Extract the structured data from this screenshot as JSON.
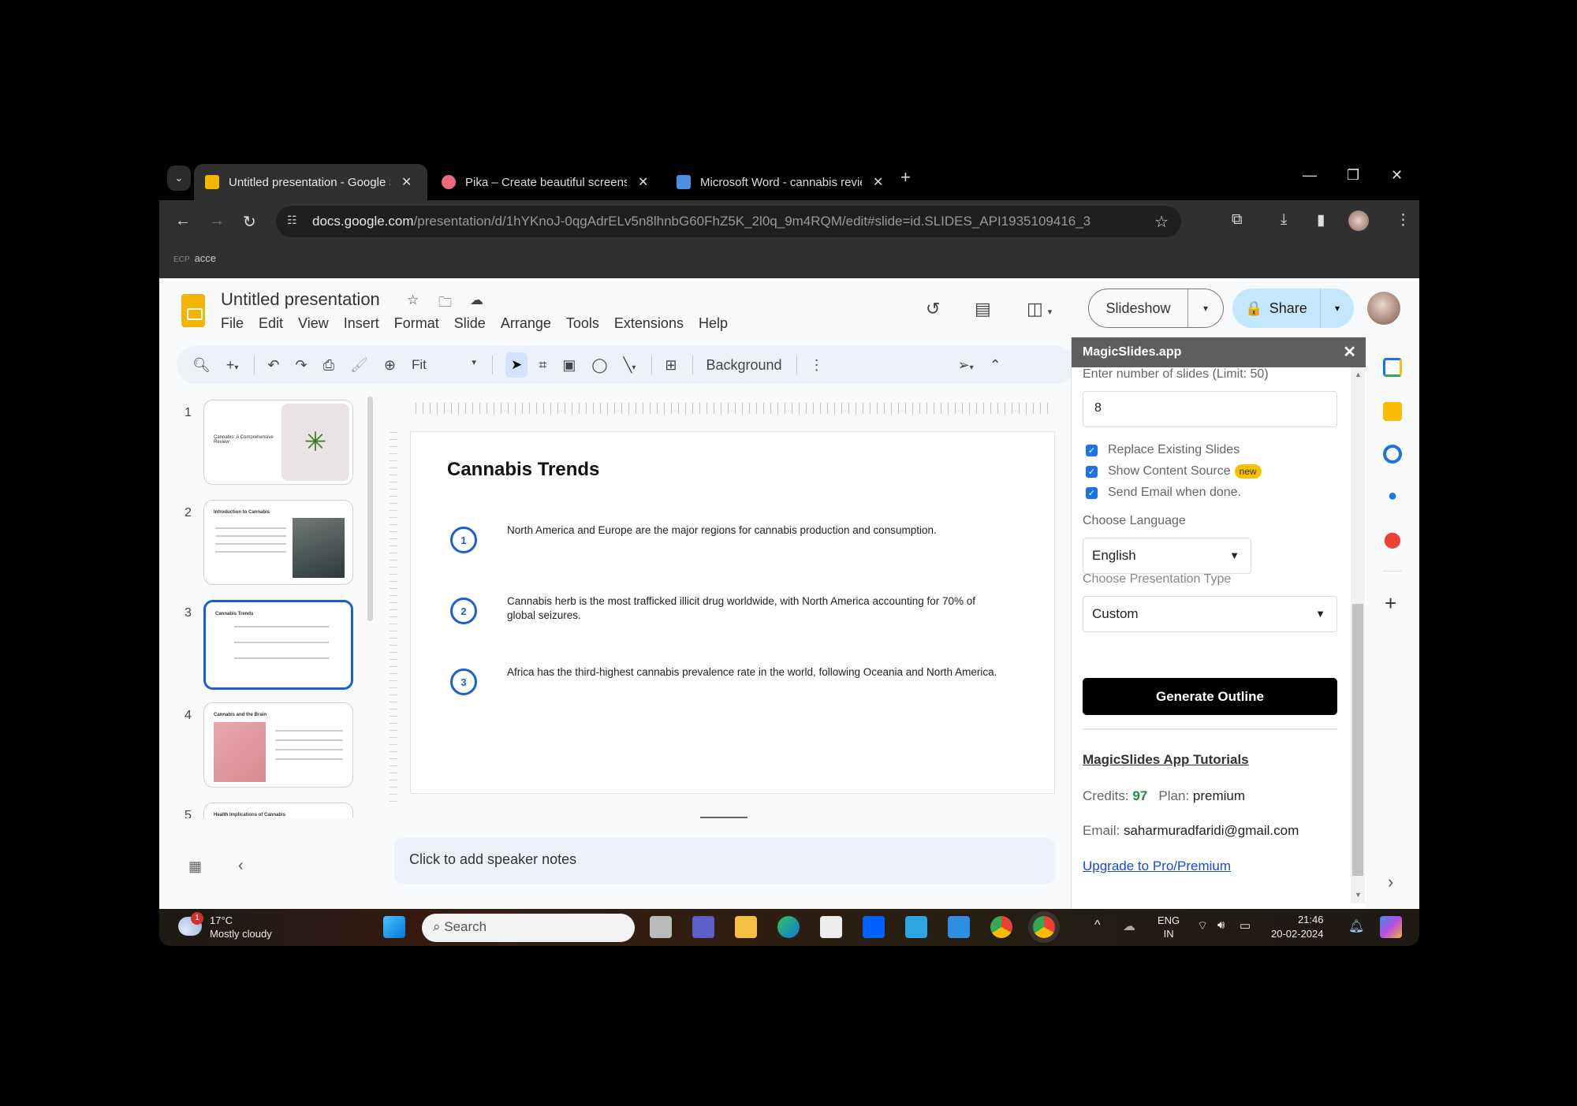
{
  "browser": {
    "tabs": [
      {
        "title": "Untitled presentation - Google S",
        "active": true,
        "favicon_color": "#f5b400"
      },
      {
        "title": "Pika – Create beautiful screensh",
        "active": false,
        "favicon_color": "#e86a7b"
      },
      {
        "title": "Microsoft Word - cannabis revie",
        "active": false,
        "favicon_color": "#4a8fe0"
      }
    ],
    "new_tab": "+",
    "url_host": "docs.google.com",
    "url_path": "/presentation/d/1hYKnoJ-0qgAdrELv5n8lhnbG60FhZ5K_2l0q_9m4RQM/edit#slide=id.SLIDES_API1935109416_3",
    "bookmark": "acce",
    "bookmark_icon": "ECP"
  },
  "slides_app": {
    "doc_title": "Untitled presentation",
    "menu": [
      "File",
      "Edit",
      "View",
      "Insert",
      "Format",
      "Slide",
      "Arrange",
      "Tools",
      "Extensions",
      "Help"
    ],
    "slideshow_label": "Slideshow",
    "share_label": "Share",
    "toolbar": {
      "zoom": "Fit",
      "background_label": "Background"
    },
    "filmstrip": [
      {
        "num": "1",
        "title": "Cannabis: A Comprehensive Review"
      },
      {
        "num": "2",
        "title": "Introduction to Cannabis"
      },
      {
        "num": "3",
        "title": "Cannabis Trends",
        "selected": true
      },
      {
        "num": "4",
        "title": "Cannabis and the Brain"
      },
      {
        "num": "5",
        "title": "Health Implications of Cannabis"
      }
    ],
    "slide": {
      "title": "Cannabis Trends",
      "bullets": [
        {
          "num": "1",
          "text": "North America and Europe are the major regions for cannabis production and consumption."
        },
        {
          "num": "2",
          "text": "Cannabis herb is the most trafficked illicit drug worldwide, with North America accounting for 70% of global seizures."
        },
        {
          "num": "3",
          "text": "Africa has the third-highest cannabis prevalence rate in the world, following Oceania and North America."
        }
      ]
    },
    "speaker_notes_placeholder": "Click to add speaker notes"
  },
  "magicslides": {
    "header": "MagicSlides.app",
    "num_slides_label": "Enter number of slides (Limit: 50)",
    "num_slides_value": "8",
    "checkboxes": [
      {
        "label": "Replace Existing Slides",
        "checked": true
      },
      {
        "label": "Show Content Source",
        "checked": true,
        "badge": "new"
      },
      {
        "label": "Send Email when done.",
        "checked": true
      }
    ],
    "language_label": "Choose Language",
    "language_value": "English",
    "type_label": "Choose Presentation Type",
    "type_value": "Custom",
    "generate_label": "Generate Outline",
    "tutorials_label": "MagicSlides App Tutorials",
    "credits_label": "Credits:",
    "credits_value": "97",
    "plan_label": "Plan:",
    "plan_value": "premium",
    "email_label": "Email:",
    "email_value": "saharmuradfaridi@gmail.com",
    "upgrade_label": "Upgrade to Pro/Premium"
  },
  "taskbar": {
    "weather_temp": "17°C",
    "weather_desc": "Mostly cloudy",
    "weather_badge": "1",
    "search_placeholder": "Search",
    "lang_line1": "ENG",
    "lang_line2": "IN",
    "time": "21:46",
    "date": "20-02-2024"
  }
}
